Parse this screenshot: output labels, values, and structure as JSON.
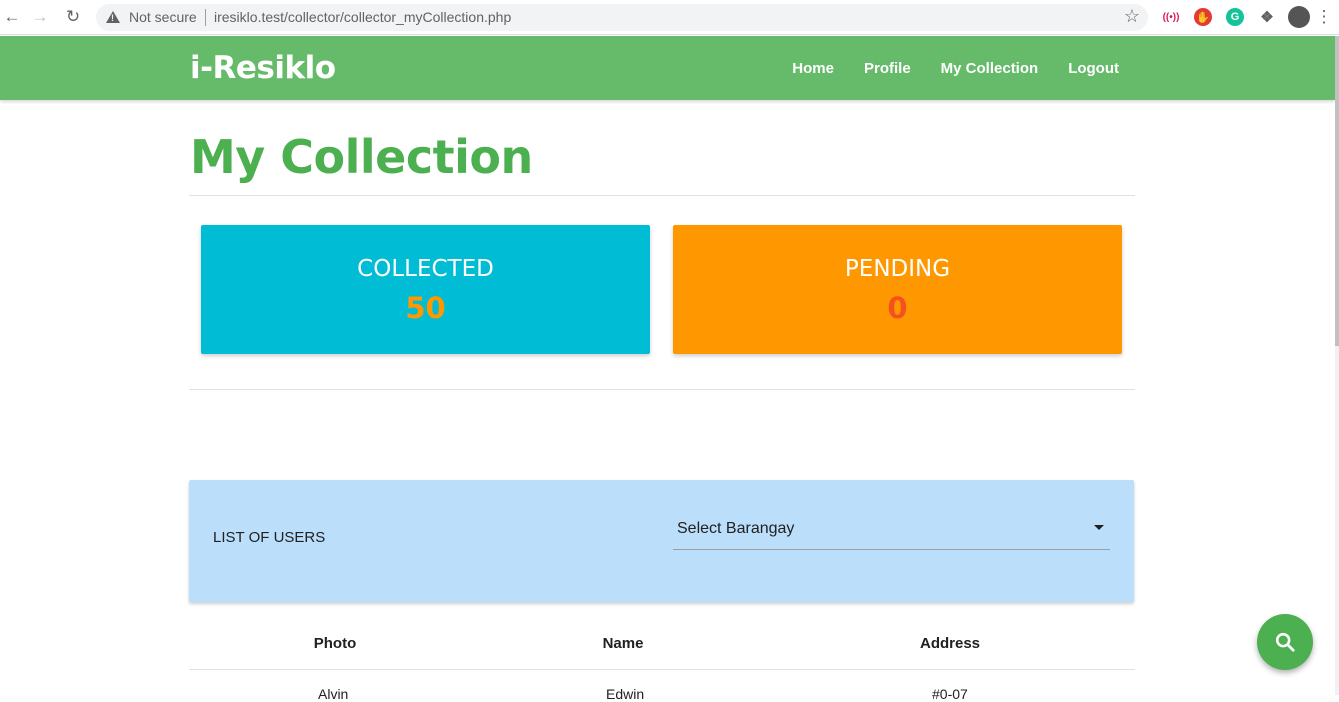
{
  "browser": {
    "security_label": "Not secure",
    "url": "iresiklo.test/collector/collector_myCollection.php"
  },
  "navbar": {
    "brand": "i-Resiklo",
    "links": [
      "Home",
      "Profile",
      "My Collection",
      "Logout"
    ]
  },
  "page": {
    "title": "My Collection"
  },
  "stats": {
    "collected": {
      "label": "COLLECTED",
      "value": "50",
      "value_color": "#ff9800",
      "bg_color": "#00bcd4"
    },
    "pending": {
      "label": "PENDING",
      "value": "0",
      "value_color": "#f4511e",
      "bg_color": "#ff9800"
    }
  },
  "users_panel": {
    "label": "LIST OF USERS",
    "select_value": "Select Barangay"
  },
  "table": {
    "headers": [
      "Photo",
      "Name",
      "Address"
    ],
    "first_row_partial": [
      "Alvin",
      "Edwin",
      "#0-07"
    ]
  },
  "colors": {
    "accent": "#66bb6a",
    "title": "#4caf50",
    "panel": "#bbdefb"
  },
  "fab": {
    "icon": "search-icon"
  }
}
